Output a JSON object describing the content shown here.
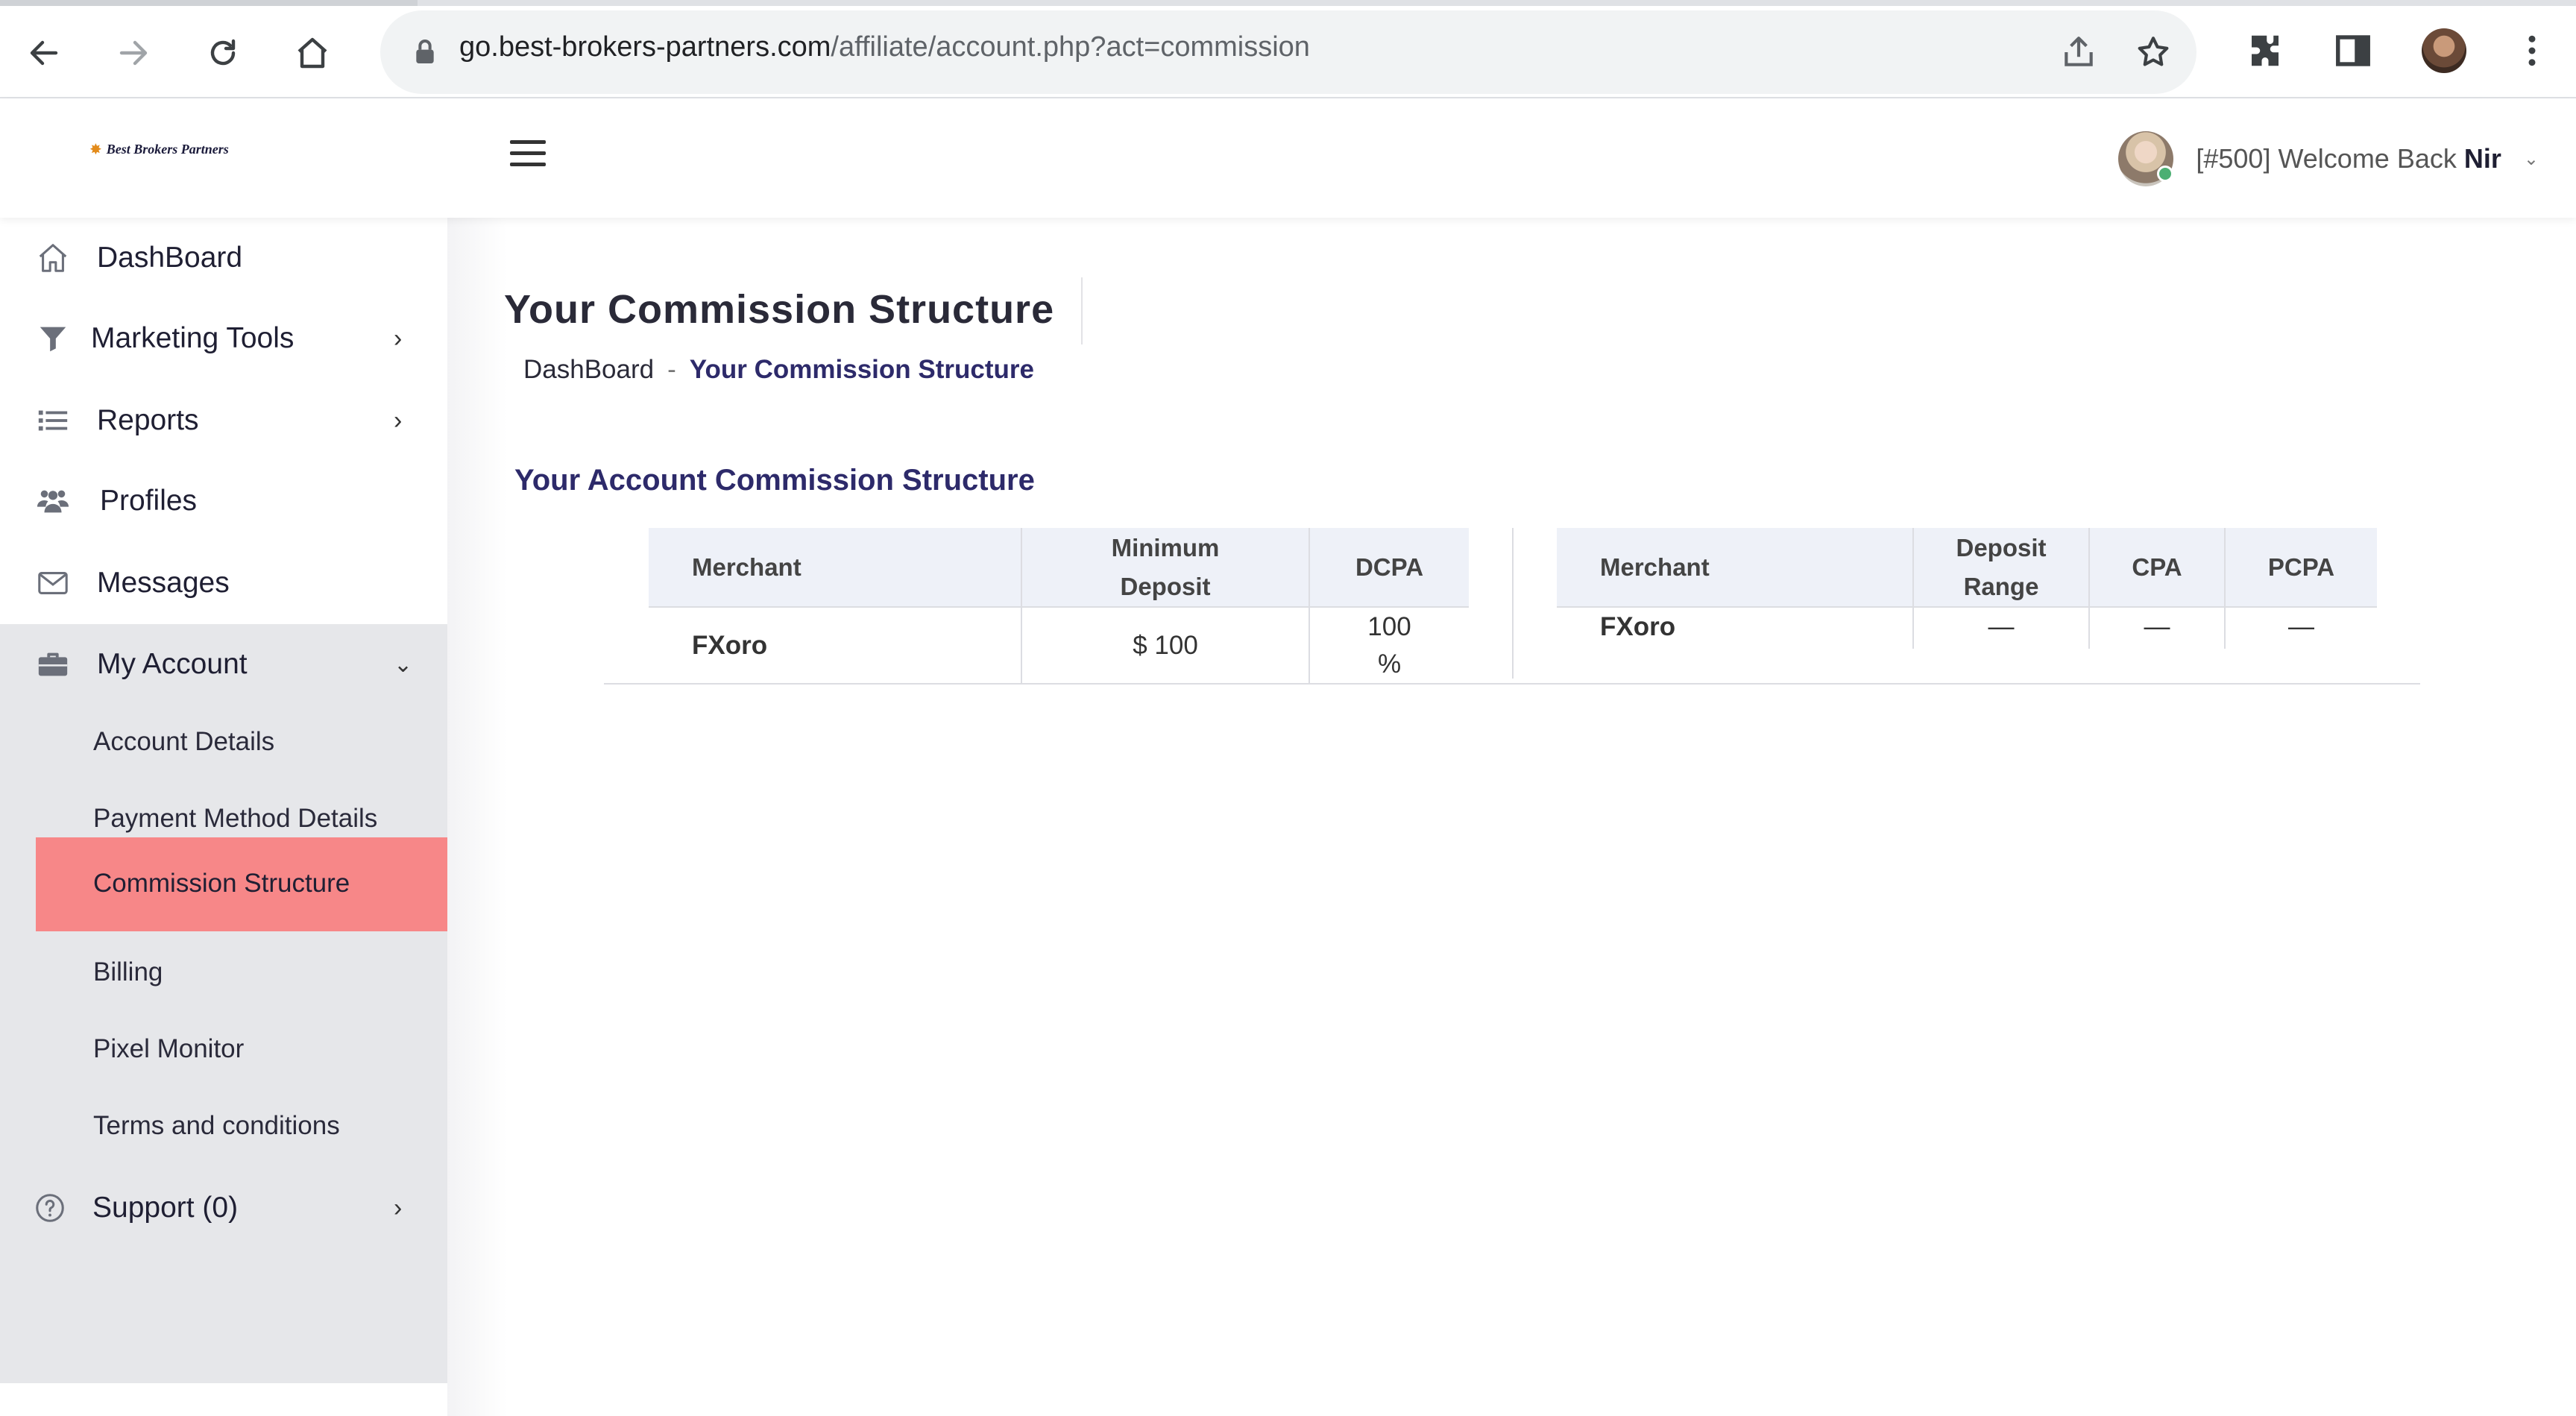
{
  "browser": {
    "url_host": "go.best-brokers-partners.com",
    "url_path": "/affiliate/account.php?act=commission"
  },
  "header": {
    "logo_text": "Best Brokers Partners",
    "welcome_prefix": "[#500] Welcome Back ",
    "user_name": "Nir"
  },
  "sidebar": {
    "items": [
      {
        "label": "DashBoard",
        "icon": "home-icon"
      },
      {
        "label": "Marketing Tools",
        "icon": "filter-icon"
      },
      {
        "label": "Reports",
        "icon": "list-icon"
      },
      {
        "label": "Profiles",
        "icon": "users-icon"
      },
      {
        "label": "Messages",
        "icon": "envelope-icon"
      },
      {
        "label": "My Account",
        "icon": "briefcase-icon"
      }
    ],
    "submenu": [
      {
        "label": "Account Details"
      },
      {
        "label": "Payment Method Details"
      },
      {
        "label": "Commission Structure"
      },
      {
        "label": "Billing"
      },
      {
        "label": "Pixel Monitor"
      },
      {
        "label": "Terms and conditions"
      }
    ],
    "support": {
      "label": "Support (0)",
      "icon": "question-circle-icon"
    }
  },
  "main": {
    "page_title": "Your Commission Structure",
    "breadcrumb": {
      "home": "DashBoard",
      "separator": "-",
      "current": "Your Commission Structure"
    },
    "section_title": "Your Account Commission Structure",
    "table_left": {
      "headers": [
        "Merchant",
        "Minimum Deposit",
        "DCPA"
      ],
      "rows": [
        [
          "FXoro",
          "$ 100",
          "100 %"
        ]
      ]
    },
    "table_right": {
      "headers": [
        "Merchant",
        "Deposit Range",
        "CPA",
        "PCPA"
      ],
      "rows": [
        [
          "FXoro",
          "—",
          "—",
          "—"
        ]
      ]
    }
  }
}
